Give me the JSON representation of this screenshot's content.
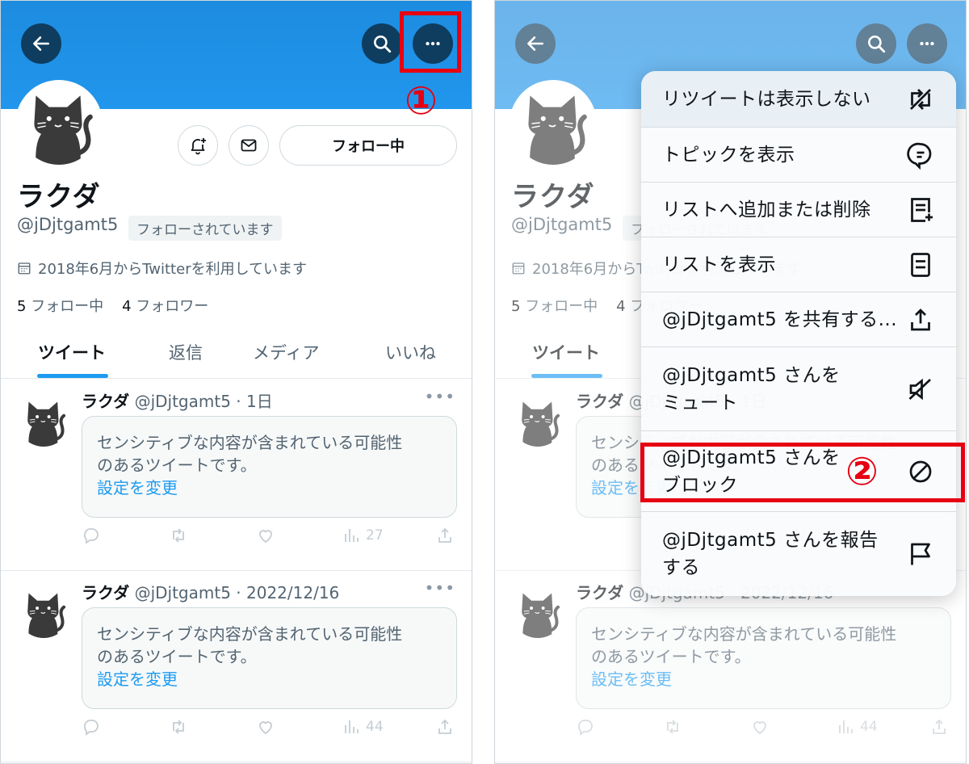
{
  "profile": {
    "name": "ラクダ",
    "handle": "@jDjtgamt5",
    "followed_badge": "フォローされています",
    "joined": "2018年6月からTwitterを利用しています",
    "following_count": "5",
    "following_label": "フォロー中",
    "followers_count": "4",
    "followers_label": "フォロワー",
    "follow_button": "フォロー中"
  },
  "tabs": [
    "ツイート",
    "返信",
    "メディア",
    "いいね"
  ],
  "tweets": [
    {
      "name": "ラクダ",
      "meta": "@jDjtgamt5 · 1日",
      "sensitive_line1": "センシティブな内容が含まれている可能性",
      "sensitive_line2": "のあるツイートです。",
      "settings_link": "設定を変更",
      "views": "27"
    },
    {
      "name": "ラクダ",
      "meta": "@jDjtgamt5 · 2022/12/16",
      "sensitive_line1": "センシティブな内容が含まれている可能性",
      "sensitive_line2": "のあるツイートです。",
      "settings_link": "設定を変更",
      "views": "44"
    }
  ],
  "menu": {
    "items": [
      {
        "label": "リツイートは表示しない",
        "icon": "retweet-off-icon"
      },
      {
        "label": "トピックを表示",
        "icon": "topic-icon"
      },
      {
        "label": "リストへ追加または削除",
        "icon": "list-add-icon"
      },
      {
        "label": "リストを表示",
        "icon": "list-icon"
      },
      {
        "label": "@jDjtgamt5 を共有する...",
        "icon": "share-icon"
      },
      {
        "label": "@jDjtgamt5 さんを\nミュート",
        "icon": "mute-icon"
      },
      {
        "label": "@jDjtgamt5 さんを\nブロック",
        "icon": "block-icon"
      },
      {
        "label": "@jDjtgamt5 さんを報告\nする",
        "icon": "flag-icon"
      }
    ]
  },
  "markers": {
    "step1": "①",
    "step2": "②"
  },
  "colors": {
    "banner": "#1d8ce0",
    "accent": "#1d9bf0",
    "marker": "#e60012"
  }
}
